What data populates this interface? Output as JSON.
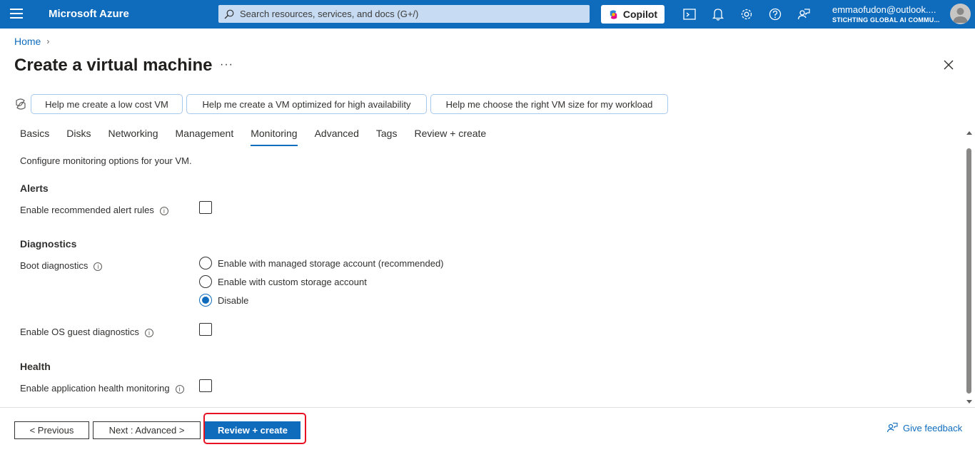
{
  "topbar": {
    "brand": "Microsoft Azure",
    "search_placeholder": "Search resources, services, and docs (G+/)",
    "copilot_label": "Copilot",
    "account_name": "emmaofudon@outlook....",
    "account_directory": "STICHTING GLOBAL AI COMMU..."
  },
  "breadcrumb": {
    "home": "Home"
  },
  "page": {
    "title": "Create a virtual machine",
    "more": "···"
  },
  "prompts": [
    "Help me create a low cost VM",
    "Help me create a VM optimized for high availability",
    "Help me choose the right VM size for my workload"
  ],
  "tabs": [
    "Basics",
    "Disks",
    "Networking",
    "Management",
    "Monitoring",
    "Advanced",
    "Tags",
    "Review + create"
  ],
  "active_tab": "Monitoring",
  "content": {
    "intro": "Configure monitoring options for your VM.",
    "alerts": {
      "heading": "Alerts",
      "enable_alert_rules": "Enable recommended alert rules",
      "enable_alert_rules_checked": false
    },
    "diagnostics": {
      "heading": "Diagnostics",
      "boot_label": "Boot diagnostics",
      "boot_options": [
        "Enable with managed storage account (recommended)",
        "Enable with custom storage account",
        "Disable"
      ],
      "boot_selected": "Disable",
      "os_guest_label": "Enable OS guest diagnostics",
      "os_guest_checked": false
    },
    "health": {
      "heading": "Health",
      "app_health_label": "Enable application health monitoring",
      "app_health_checked": false
    }
  },
  "footer": {
    "previous": "< Previous",
    "next": "Next : Advanced >",
    "review_create": "Review + create",
    "feedback": "Give feedback"
  },
  "colors": {
    "accent": "#0f6cbd",
    "highlight": "#e81123",
    "prompt_border": "#a6c8ec"
  }
}
